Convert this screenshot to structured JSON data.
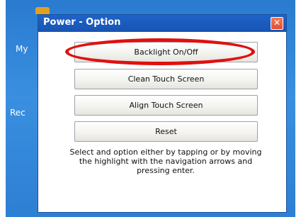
{
  "desktop": {
    "labels": [
      "My",
      "Rec"
    ]
  },
  "dialog": {
    "title": "Power - Option",
    "close_glyph": "✕",
    "options": [
      {
        "label": "Backlight On/Off"
      },
      {
        "label": "Clean Touch Screen"
      },
      {
        "label": "Align Touch Screen"
      },
      {
        "label": "Reset"
      }
    ],
    "help_text": "Select and option either by tapping or by moving the highlight with the navigation arrows and pressing enter."
  },
  "icons": {
    "close": "close-icon",
    "highlight": "red-ellipse-annotation"
  },
  "colors": {
    "titlebar": "#1f63c9",
    "desktop": "#2d7fd4",
    "close": "#e0502e",
    "annotation": "#e01010"
  }
}
